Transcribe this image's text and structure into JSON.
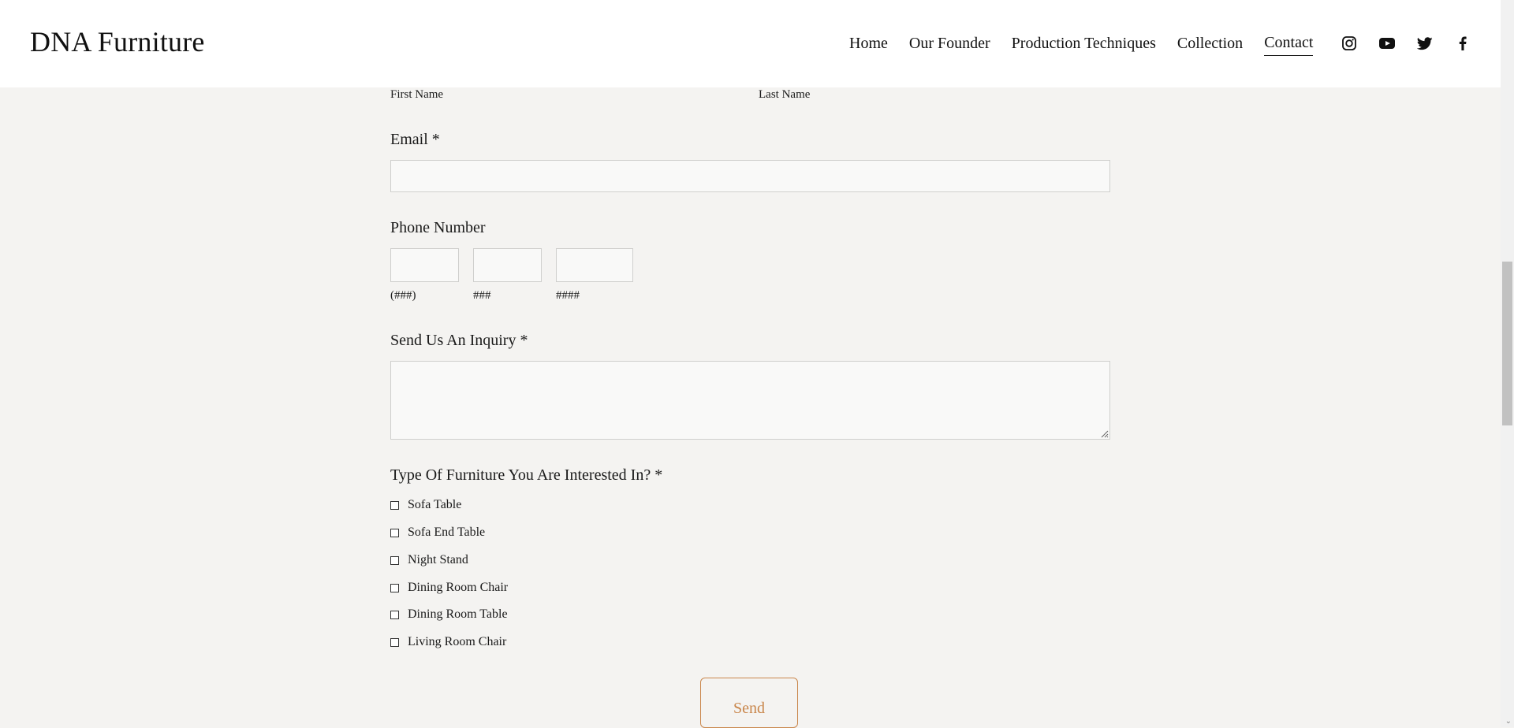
{
  "header": {
    "logo": "DNA Furniture",
    "nav": [
      {
        "label": "Home"
      },
      {
        "label": "Our Founder"
      },
      {
        "label": "Production Techniques"
      },
      {
        "label": "Collection"
      },
      {
        "label": "Contact",
        "active": true
      }
    ],
    "social_icons": [
      "instagram-icon",
      "youtube-icon",
      "twitter-icon",
      "facebook-icon"
    ]
  },
  "form": {
    "first_name_label": "First Name",
    "last_name_label": "Last Name",
    "email_label": "Email *",
    "phone_label": "Phone Number",
    "phone_hints": [
      "(###)",
      "###",
      "####"
    ],
    "inquiry_label": "Send Us An Inquiry *",
    "furniture_label": "Type Of Furniture You Are Interested In? *",
    "furniture_options": [
      "Sofa Table",
      "Sofa End Table",
      "Night Stand",
      "Dining Room Chair",
      "Dining Room Table",
      "Living Room Chair"
    ],
    "submit_label": "Send"
  },
  "colors": {
    "page_bg": "#f4f3f1",
    "header_bg": "#ffffff",
    "accent": "#c9864b"
  }
}
